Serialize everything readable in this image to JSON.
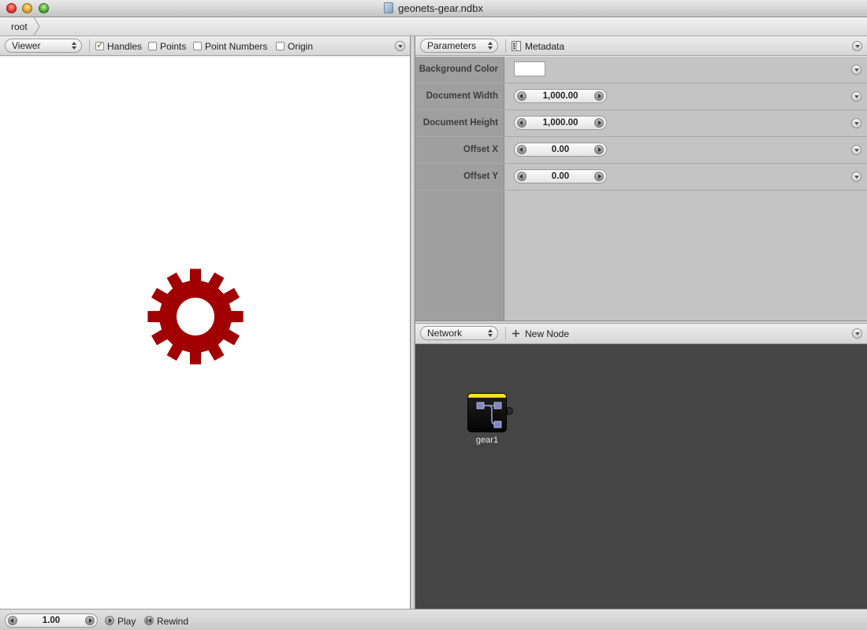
{
  "window": {
    "title": "geonets-gear.ndbx"
  },
  "breadcrumb": {
    "items": [
      "root"
    ]
  },
  "viewer": {
    "mode": "Viewer",
    "options": [
      {
        "label": "Handles",
        "checked": true
      },
      {
        "label": "Points",
        "checked": false
      },
      {
        "label": "Point Numbers",
        "checked": false
      },
      {
        "label": "Origin",
        "checked": false
      }
    ],
    "gear_color": "#a00000",
    "gear_teeth": 12
  },
  "parameters": {
    "mode": "Parameters",
    "metadata_label": "Metadata",
    "rows": [
      {
        "label": "Background Color",
        "type": "color",
        "value": "#ffffff"
      },
      {
        "label": "Document Width",
        "type": "number",
        "value": "1,000.00"
      },
      {
        "label": "Document Height",
        "type": "number",
        "value": "1,000.00"
      },
      {
        "label": "Offset X",
        "type": "number",
        "value": "0.00"
      },
      {
        "label": "Offset Y",
        "type": "number",
        "value": "0.00"
      }
    ]
  },
  "network": {
    "mode": "Network",
    "new_node_label": "New Node",
    "nodes": [
      {
        "name": "gear1",
        "accent": "#f2e11d"
      }
    ]
  },
  "playback": {
    "frame": "1.00",
    "play_label": "Play",
    "rewind_label": "Rewind"
  }
}
